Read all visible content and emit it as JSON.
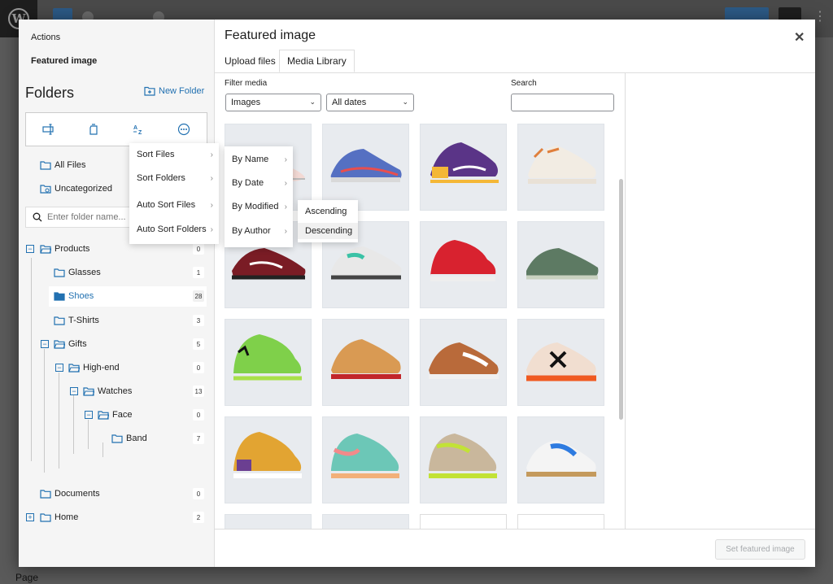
{
  "background": {
    "footer_label": "Page"
  },
  "sidebar": {
    "actions_label": "Actions",
    "featured_link": "Featured image",
    "folders_title": "Folders",
    "new_folder": "New Folder",
    "search_placeholder": "Enter folder name...",
    "all_files": "All Files",
    "uncategorized": "Uncategorized",
    "folders": [
      {
        "label": "Products",
        "count": "0"
      },
      {
        "label": "Glasses",
        "count": "1"
      },
      {
        "label": "Shoes",
        "count": "28"
      },
      {
        "label": "T-Shirts",
        "count": "3"
      },
      {
        "label": "Gifts",
        "count": "5"
      },
      {
        "label": "High-end",
        "count": "0"
      },
      {
        "label": "Watches",
        "count": "13"
      },
      {
        "label": "Face",
        "count": "0"
      },
      {
        "label": "Band",
        "count": "7"
      },
      {
        "label": "Documents",
        "count": "0"
      },
      {
        "label": "Home",
        "count": "2"
      }
    ]
  },
  "sort_menu": {
    "items": [
      "Sort Files",
      "Sort Folders",
      "Auto Sort Files",
      "Auto Sort Folders"
    ],
    "sub_items": [
      "By Name",
      "By Date",
      "By Modified",
      "By Author"
    ],
    "order_items": [
      "Ascending",
      "Descending"
    ]
  },
  "modal": {
    "title": "Featured image",
    "tabs": [
      "Upload files",
      "Media Library"
    ],
    "filter_label": "Filter media",
    "filter_type": "Images",
    "filter_date": "All dates",
    "search_label": "Search",
    "set_button": "Set featured image"
  },
  "colors": {
    "accent": "#2271b1",
    "selected_folder_text": "#2271b1"
  }
}
